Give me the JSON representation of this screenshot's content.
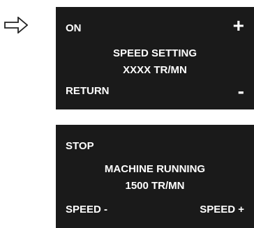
{
  "pointer": {
    "icon": "right-arrow-icon"
  },
  "screen_speed_setting": {
    "top_left": "ON",
    "top_right": "+",
    "line1": "SPEED SETTING",
    "line2": "XXXX TR/MN",
    "bottom_left": "RETURN",
    "bottom_right": "-"
  },
  "screen_machine_running": {
    "top_left": "STOP",
    "line1": "MACHINE RUNNING",
    "line2": "1500 TR/MN",
    "bottom_left": "SPEED -",
    "bottom_right": "SPEED +"
  }
}
